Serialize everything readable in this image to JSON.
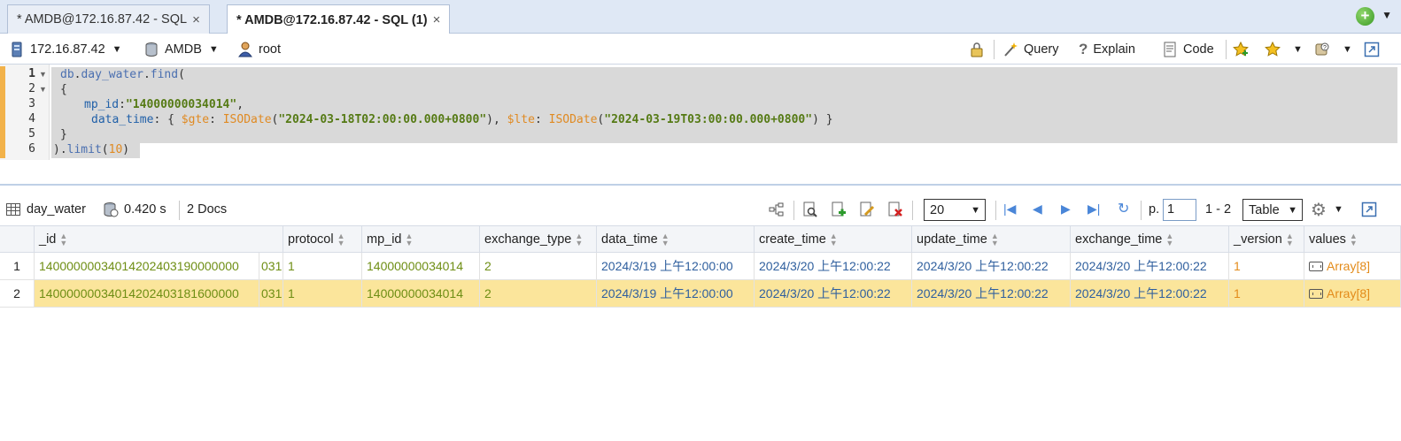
{
  "tabs": [
    {
      "label": "* AMDB@172.16.87.42 - SQL",
      "close": "×"
    },
    {
      "label": "* AMDB@172.16.87.42 - SQL (1)",
      "close": "×"
    }
  ],
  "connection": {
    "host": "172.16.87.42",
    "database": "AMDB",
    "user": "root"
  },
  "toolbar": {
    "query_label": "Query",
    "explain_label": "Explain",
    "code_label": "Code"
  },
  "editor": {
    "line_numbers": [
      "1",
      "2",
      "3",
      "4",
      "5",
      "6"
    ],
    "l1_db": "db",
    "l1_dot1": ".",
    "l1_coll": "day_water",
    "l1_dot2": ".",
    "l1_find": "find",
    "l1_paren": "(",
    "l2": "{",
    "l3_key": "mp_id",
    "l3_colon": ":",
    "l3_val": "\"14000000034014\"",
    "l3_comma": ",",
    "l4_key": "data_time",
    "l4_p1": ": { ",
    "l4_gte": "$gte",
    "l4_p2": ": ",
    "l4_fn1": "ISODate",
    "l4_p3": "(",
    "l4_d1": "\"2024-03-18T02:00:00.000+0800\"",
    "l4_p4": "), ",
    "l4_lte": "$lte",
    "l4_p5": ": ",
    "l4_fn2": "ISODate",
    "l4_p6": "(",
    "l4_d2": "\"2024-03-19T03:00:00.000+0800\"",
    "l4_p7": ") }",
    "l5": "}",
    "l6_a": ").",
    "l6_limit": "limit",
    "l6_b": "(",
    "l6_num": "10",
    "l6_c": ")"
  },
  "results": {
    "collection": "day_water",
    "time": "0.420 s",
    "docs": "2 Docs",
    "page_size": "20",
    "page_label": "p.",
    "page": "1",
    "range": "1 - 2",
    "view": "Table"
  },
  "grid": {
    "columns": [
      "_id",
      "protocol",
      "mp_id",
      "exchange_type",
      "data_time",
      "create_time",
      "update_time",
      "exchange_time",
      "_version",
      "values"
    ],
    "rows": [
      {
        "num": "1",
        "id": "14000000034014202403190000000",
        "id_tail": "031",
        "protocol": "1",
        "mp_id": "14000000034014",
        "exchange_type": "2",
        "data_time": "2024/3/19 上午12:00:00",
        "create_time": "2024/3/20 上午12:00:22",
        "update_time": "2024/3/20 上午12:00:22",
        "exchange_time": "2024/3/20 上午12:00:22",
        "version": "1",
        "values_label": "Array",
        "values_count": "[8]"
      },
      {
        "num": "2",
        "id": "14000000034014202403181600000",
        "id_tail": "031",
        "protocol": "1",
        "mp_id": "14000000034014",
        "exchange_type": "2",
        "data_time": "2024/3/19 上午12:00:00",
        "create_time": "2024/3/20 上午12:00:22",
        "update_time": "2024/3/20 上午12:00:22",
        "exchange_time": "2024/3/20 上午12:00:22",
        "version": "1",
        "values_label": "Array",
        "values_count": "[8]"
      }
    ]
  },
  "colors": {
    "selected_row": "#fbe59b",
    "string_green": "#6e8e14",
    "date_blue": "#2f5f9e",
    "number_orange": "#e38b1a",
    "gutter_marker": "#f2b24a"
  }
}
